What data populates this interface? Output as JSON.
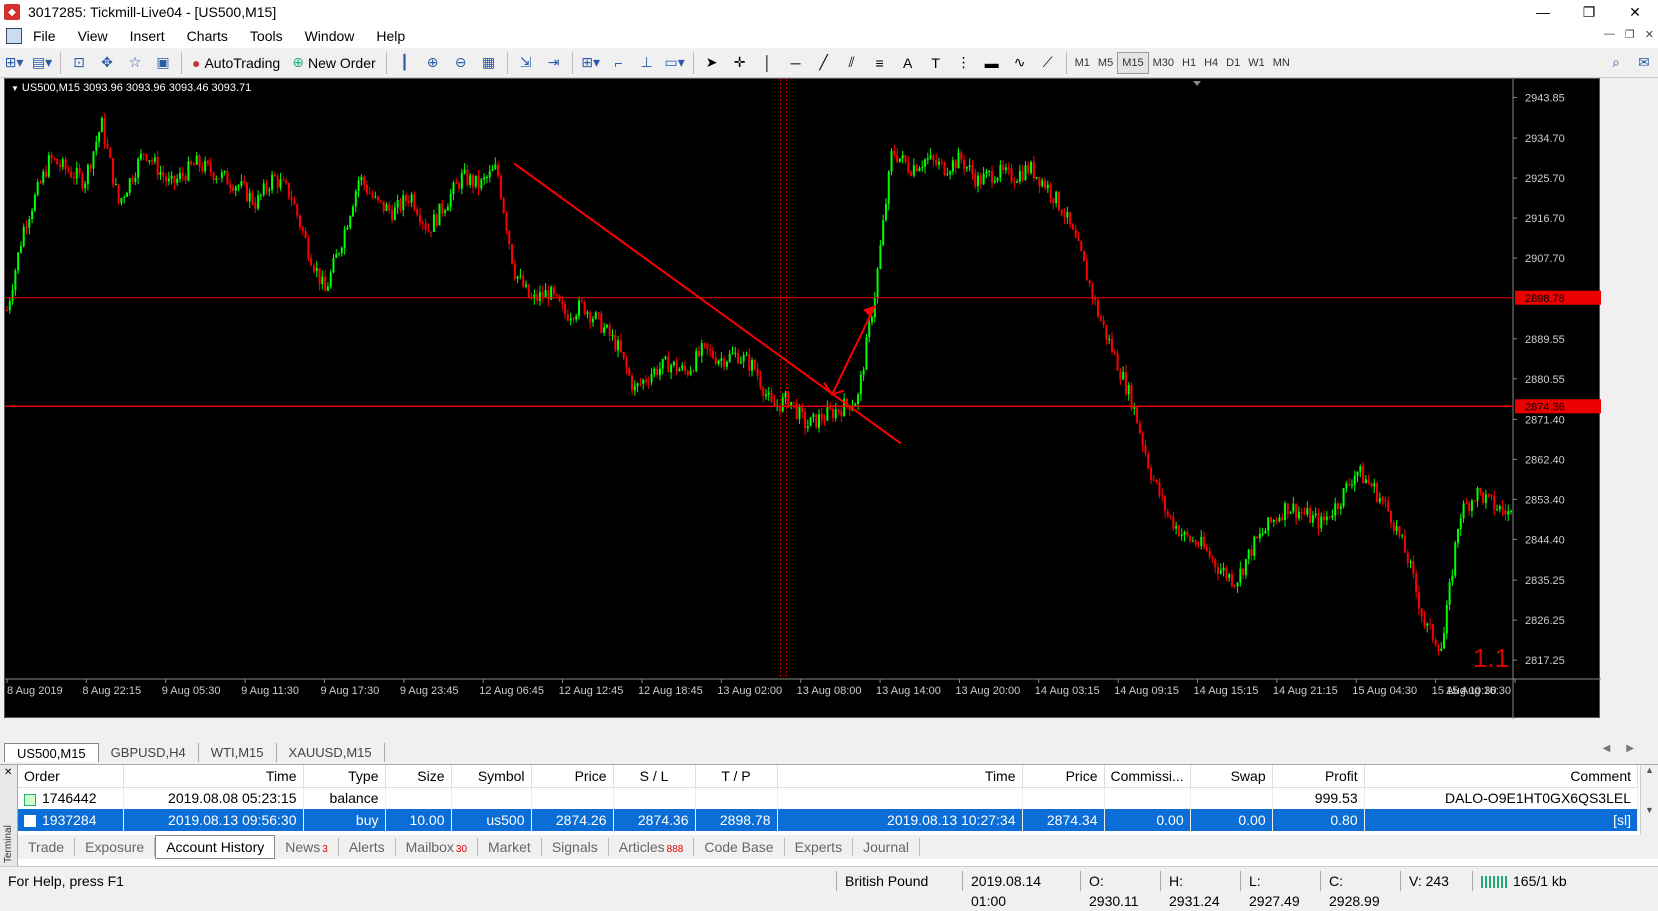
{
  "window": {
    "title": "3017285: Tickmill-Live04 - [US500,M15]",
    "minimize": "—",
    "restore": "❐",
    "close": "✕"
  },
  "menu": [
    "File",
    "View",
    "Insert",
    "Charts",
    "Tools",
    "Window",
    "Help"
  ],
  "toolbar": {
    "autotrading": "AutoTrading",
    "new_order": "New Order",
    "timeframes": [
      "M1",
      "M5",
      "M15",
      "M30",
      "H1",
      "H4",
      "D1",
      "W1",
      "MN"
    ],
    "active_timeframe": "M15"
  },
  "chart": {
    "symbol_label": "US500,M15  3093.96 3093.96 3093.46 3093.71",
    "watermark": "1.1",
    "up_color": "#00ff00",
    "down_color": "#ff0000",
    "price_labels": [
      "2943.85",
      "2934.70",
      "2925.70",
      "2916.70",
      "2907.70",
      "2898.78",
      "2889.55",
      "2880.55",
      "2874.36",
      "2871.40",
      "2862.40",
      "2853.40",
      "2844.40",
      "2835.25",
      "2826.25",
      "2817.25"
    ],
    "time_labels": [
      "8 Aug 2019",
      "8 Aug 22:15",
      "9 Aug 05:30",
      "9 Aug 11:30",
      "9 Aug 17:30",
      "9 Aug 23:45",
      "12 Aug 06:45",
      "12 Aug 12:45",
      "12 Aug 18:45",
      "13 Aug 02:00",
      "13 Aug 08:00",
      "13 Aug 14:00",
      "13 Aug 20:00",
      "14 Aug 03:15",
      "14 Aug 09:15",
      "14 Aug 15:15",
      "14 Aug 21:15",
      "15 Aug 04:30",
      "15 Aug 10:30",
      "15 Aug 16:30"
    ],
    "tp_line": "2898.78",
    "sl_line": "2874.36"
  },
  "chart_data": {
    "type": "candlestick",
    "symbol": "US500",
    "timeframe": "M15",
    "ylim": [
      2813,
      2948
    ],
    "price_path": [
      [
        0,
        2896
      ],
      [
        2,
        2915
      ],
      [
        5,
        2930
      ],
      [
        9,
        2925
      ],
      [
        11,
        2938
      ],
      [
        13,
        2920
      ],
      [
        16,
        2932
      ],
      [
        19,
        2924
      ],
      [
        22,
        2929
      ],
      [
        25,
        2926
      ],
      [
        27,
        2924
      ],
      [
        29,
        2920
      ],
      [
        31,
        2926
      ],
      [
        33,
        2922
      ],
      [
        35,
        2910
      ],
      [
        37,
        2900
      ],
      [
        39,
        2912
      ],
      [
        41,
        2926
      ],
      [
        43,
        2920
      ],
      [
        45,
        2918
      ],
      [
        47,
        2922
      ],
      [
        49,
        2914
      ],
      [
        51,
        2920
      ],
      [
        53,
        2926
      ],
      [
        55,
        2924
      ],
      [
        57,
        2928
      ],
      [
        59,
        2905
      ],
      [
        61,
        2898
      ],
      [
        63,
        2900
      ],
      [
        65,
        2895
      ],
      [
        67,
        2897
      ],
      [
        69,
        2893
      ],
      [
        71,
        2888
      ],
      [
        73,
        2878
      ],
      [
        75,
        2882
      ],
      [
        77,
        2884
      ],
      [
        79,
        2882
      ],
      [
        81,
        2887
      ],
      [
        83,
        2885
      ],
      [
        85,
        2886
      ],
      [
        87,
        2883
      ],
      [
        89,
        2874
      ],
      [
        91,
        2876
      ],
      [
        93,
        2870
      ],
      [
        95,
        2872
      ],
      [
        97,
        2874
      ],
      [
        99,
        2876
      ],
      [
        101,
        2900
      ],
      [
        103,
        2932
      ],
      [
        105,
        2928
      ],
      [
        107,
        2930
      ],
      [
        109,
        2928
      ],
      [
        111,
        2930
      ],
      [
        113,
        2925
      ],
      [
        115,
        2927
      ],
      [
        117,
        2926
      ],
      [
        119,
        2928
      ],
      [
        121,
        2924
      ],
      [
        123,
        2918
      ],
      [
        125,
        2908
      ],
      [
        127,
        2895
      ],
      [
        129,
        2885
      ],
      [
        131,
        2875
      ],
      [
        133,
        2860
      ],
      [
        135,
        2850
      ],
      [
        137,
        2845
      ],
      [
        139,
        2843
      ],
      [
        141,
        2838
      ],
      [
        143,
        2835
      ],
      [
        145,
        2843
      ],
      [
        147,
        2848
      ],
      [
        149,
        2852
      ],
      [
        151,
        2850
      ],
      [
        153,
        2848
      ],
      [
        155,
        2853
      ],
      [
        157,
        2860
      ],
      [
        159,
        2856
      ],
      [
        161,
        2850
      ],
      [
        163,
        2840
      ],
      [
        165,
        2825
      ],
      [
        167,
        2820
      ],
      [
        169,
        2850
      ],
      [
        171,
        2855
      ],
      [
        173,
        2852
      ],
      [
        175,
        2850
      ]
    ],
    "horizontal_lines": [
      2898.78,
      2874.36
    ],
    "trendline": {
      "from": [
        59,
        2929
      ],
      "to": [
        104,
        2866
      ]
    },
    "arrow_annotation": {
      "from": [
        96,
        2877
      ],
      "to": [
        101,
        2897
      ]
    }
  },
  "chart_tabs": [
    "US500,M15",
    "GBPUSD,H4",
    "WTI,M15",
    "XAUUSD,M15"
  ],
  "terminal": {
    "side_label": "Terminal",
    "columns": [
      "Order",
      "Time",
      "Type",
      "Size",
      "Symbol",
      "Price",
      "S / L",
      "T / P",
      "Time",
      "Price",
      "Commissi...",
      "Swap",
      "Profit",
      "Comment"
    ],
    "rows": [
      {
        "order": "1746442",
        "time": "2019.08.08 05:23:15",
        "type": "balance",
        "size": "",
        "symbol": "",
        "price": "",
        "sl": "",
        "tp": "",
        "close_time": "",
        "close_price": "",
        "commission": "",
        "swap": "",
        "profit": "999.53",
        "comment": "DALO-O9E1HT0GX6QS3LEL"
      },
      {
        "order": "1937284",
        "time": "2019.08.13 09:56:30",
        "type": "buy",
        "size": "10.00",
        "symbol": "us500",
        "price": "2874.26",
        "sl": "2874.36",
        "tp": "2898.78",
        "close_time": "2019.08.13 10:27:34",
        "close_price": "2874.34",
        "commission": "0.00",
        "swap": "0.00",
        "profit": "0.80",
        "comment": "[sl]"
      }
    ],
    "tabs": [
      {
        "label": "Trade",
        "badge": ""
      },
      {
        "label": "Exposure",
        "badge": ""
      },
      {
        "label": "Account History",
        "badge": ""
      },
      {
        "label": "News",
        "badge": "3"
      },
      {
        "label": "Alerts",
        "badge": ""
      },
      {
        "label": "Mailbox",
        "badge": "30"
      },
      {
        "label": "Market",
        "badge": ""
      },
      {
        "label": "Signals",
        "badge": ""
      },
      {
        "label": "Articles",
        "badge": "888"
      },
      {
        "label": "Code Base",
        "badge": ""
      },
      {
        "label": "Experts",
        "badge": ""
      },
      {
        "label": "Journal",
        "badge": ""
      }
    ],
    "active_tab": "Account History"
  },
  "status": {
    "help": "For Help, press F1",
    "profile": "British Pound",
    "datetime": "2019.08.14 01:00",
    "open": "O: 2930.11",
    "high": "H: 2931.24",
    "low": "L: 2927.49",
    "close": "C: 2928.99",
    "volume": "V: 243",
    "traffic": "165/1 kb"
  }
}
